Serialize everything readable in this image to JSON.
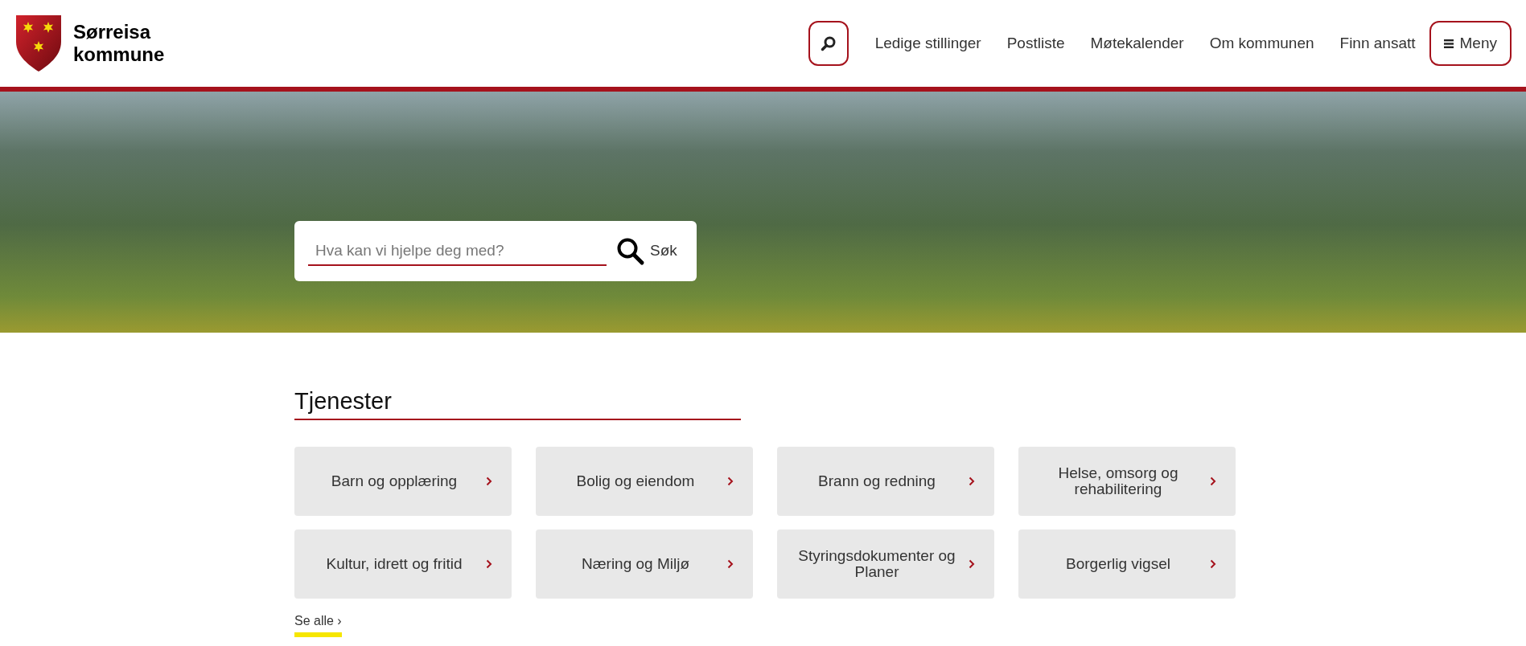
{
  "header": {
    "logo_text": [
      "Sørreisa",
      "kommune"
    ],
    "nav": [
      "Ledige stillinger",
      "Postliste",
      "Møtekalender",
      "Om kommunen",
      "Finn ansatt"
    ],
    "menu_button": "Meny"
  },
  "hero": {
    "search": {
      "placeholder": "Hva kan vi hjelpe deg med?",
      "button": "Søk"
    }
  },
  "services": {
    "title": "Tjenester",
    "tiles": [
      {
        "label": "Barn og opplæring"
      },
      {
        "label": "Bolig og eiendom"
      },
      {
        "label": "Brann og redning"
      },
      {
        "label": "Helse, omsorg og rehabilitering"
      },
      {
        "label": "Kultur, idrett og fritid"
      },
      {
        "label": "Næring og Miljø"
      },
      {
        "label": "Styringsdokumenter og Planer"
      },
      {
        "label": "Borgerlig vigsel"
      }
    ],
    "see_all": "Se alle ›"
  }
}
